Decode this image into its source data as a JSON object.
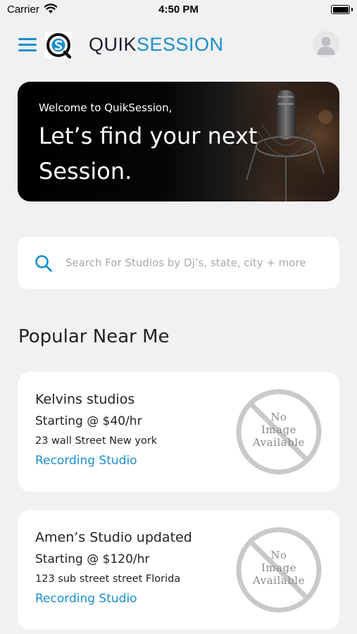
{
  "status_bar": {
    "carrier": "Carrier",
    "time": "4:50 PM"
  },
  "header": {
    "brand_part1": "QUIK",
    "brand_part2": "SESSION"
  },
  "hero": {
    "welcome": "Welcome to QuikSession,",
    "headline": "Let’s find your next Session."
  },
  "search": {
    "placeholder": "Search For Studios by Dj’s, state, city + more",
    "value": ""
  },
  "section": {
    "title": "Popular Near Me"
  },
  "studios": [
    {
      "name": "Kelvins studios",
      "price": "Starting @ $40/hr",
      "address": "23 wall Street New york",
      "type": "Recording Studio",
      "no_image_line1": "No",
      "no_image_line2": "Image",
      "no_image_line3": "Available"
    },
    {
      "name": "Amen’s Studio updated",
      "price": "Starting @ $120/hr",
      "address": "123 sub street street Florida",
      "type": "Recording Studio",
      "no_image_line1": "No",
      "no_image_line2": "Image",
      "no_image_line3": "Available"
    }
  ],
  "colors": {
    "accent": "#1a8fcf",
    "background": "#f1f1f2",
    "card": "#ffffff",
    "placeholder_text": "#a8a8ad"
  },
  "icons": [
    "wifi-icon",
    "battery-icon",
    "menu-icon",
    "logo-icon",
    "avatar-icon",
    "search-icon",
    "no-image-icon"
  ]
}
